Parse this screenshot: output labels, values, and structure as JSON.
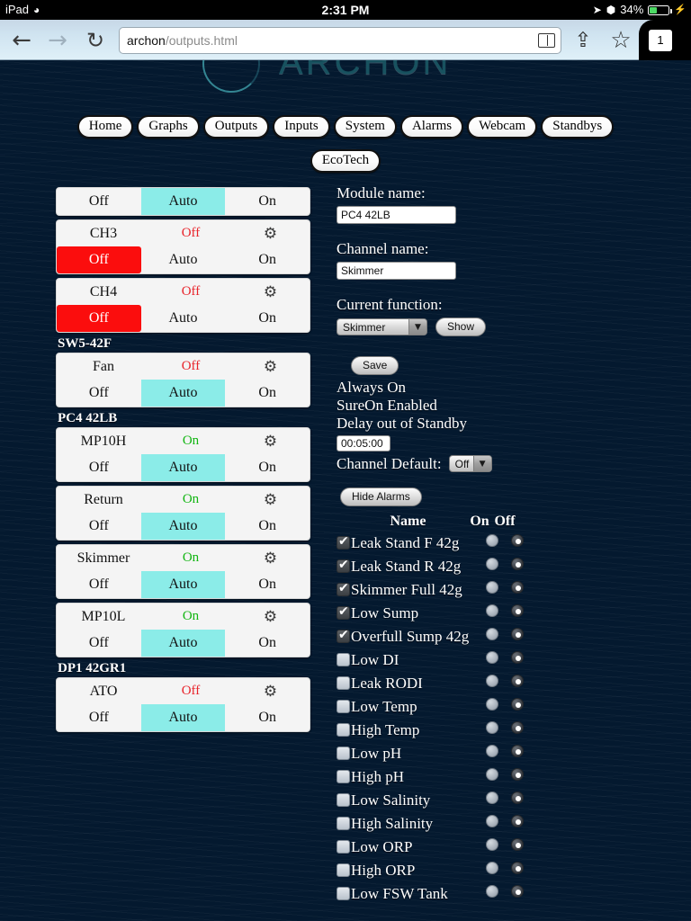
{
  "status_bar": {
    "device": "iPad",
    "wifi_icon": "wifi-icon",
    "time": "2:31 PM",
    "location_icon": "location-arrow-icon",
    "bluetooth_icon": "bluetooth-icon",
    "battery_percent": "34%",
    "charging_icon": "lightning-bolt-icon",
    "battery_level": 34
  },
  "browser": {
    "back_icon": "back-arrow-icon",
    "forward_icon": "forward-arrow-icon",
    "reload_icon": "reload-icon",
    "url_host": "archon",
    "url_path": "/outputs.html",
    "reader_icon": "reader-view-icon",
    "share_icon": "share-icon",
    "bookmark_icon": "bookmark-star-icon",
    "tab_count": "1"
  },
  "site": {
    "logo_text": "ARCHON",
    "nav": [
      {
        "label": "Home"
      },
      {
        "label": "Graphs"
      },
      {
        "label": "Outputs"
      },
      {
        "label": "Inputs"
      },
      {
        "label": "System"
      },
      {
        "label": "Alarms"
      },
      {
        "label": "Webcam"
      },
      {
        "label": "Standbys"
      }
    ],
    "subnav": [
      {
        "label": "EcoTech"
      }
    ]
  },
  "channels": {
    "partial_top": {
      "off_label": "Off",
      "auto_label": "Auto",
      "on_label": "On",
      "selected": "Auto"
    },
    "groups": [
      {
        "label": "",
        "items": [
          {
            "name": "CH3",
            "state": "Off",
            "state_kind": "off",
            "selected": "Off",
            "off_label": "Off",
            "auto_label": "Auto",
            "on_label": "On",
            "gear_icon": "gear-icon"
          },
          {
            "name": "CH4",
            "state": "Off",
            "state_kind": "off",
            "selected": "Off",
            "off_label": "Off",
            "auto_label": "Auto",
            "on_label": "On",
            "gear_icon": "gear-icon"
          }
        ]
      },
      {
        "label": "SW5-42F",
        "items": [
          {
            "name": "Fan",
            "state": "Off",
            "state_kind": "off",
            "selected": "Auto",
            "off_label": "Off",
            "auto_label": "Auto",
            "on_label": "On",
            "gear_icon": "gear-icon"
          }
        ]
      },
      {
        "label": "PC4 42LB",
        "items": [
          {
            "name": "MP10H",
            "state": "On",
            "state_kind": "on",
            "selected": "Auto",
            "off_label": "Off",
            "auto_label": "Auto",
            "on_label": "On",
            "gear_icon": "gear-icon"
          },
          {
            "name": "Return",
            "state": "On",
            "state_kind": "on",
            "selected": "Auto",
            "off_label": "Off",
            "auto_label": "Auto",
            "on_label": "On",
            "gear_icon": "gear-icon"
          },
          {
            "name": "Skimmer",
            "state": "On",
            "state_kind": "on",
            "selected": "Auto",
            "off_label": "Off",
            "auto_label": "Auto",
            "on_label": "On",
            "gear_icon": "gear-icon"
          },
          {
            "name": "MP10L",
            "state": "On",
            "state_kind": "on",
            "selected": "Auto",
            "off_label": "Off",
            "auto_label": "Auto",
            "on_label": "On",
            "gear_icon": "gear-icon"
          }
        ]
      },
      {
        "label": "DP1 42GR1",
        "items": [
          {
            "name": "ATO",
            "state": "Off",
            "state_kind": "off",
            "selected": "Auto",
            "off_label": "Off",
            "auto_label": "Auto",
            "on_label": "On",
            "gear_icon": "gear-icon"
          }
        ]
      }
    ]
  },
  "form": {
    "module_name_label": "Module name:",
    "module_name_value": "PC4 42LB",
    "channel_name_label": "Channel name:",
    "channel_name_value": "Skimmer",
    "current_function_label": "Current function:",
    "current_function_value": "Skimmer",
    "show_button": "Show",
    "save_button": "Save",
    "always_on": "Always On",
    "sure_on": "SureOn Enabled",
    "delay_label": "Delay out of Standby",
    "delay_value": "00:05:00",
    "channel_default_label": "Channel Default:",
    "channel_default_value": "Off",
    "dropdown_arrow_icon": "chevron-down-icon"
  },
  "alarms": {
    "hide_button": "Hide Alarms",
    "col_name": "Name",
    "col_on": "On",
    "col_off": "Off",
    "rows": [
      {
        "name": "Leak Stand F 42g",
        "checked": true,
        "mode": "Off"
      },
      {
        "name": "Leak Stand R 42g",
        "checked": true,
        "mode": "Off"
      },
      {
        "name": "Skimmer Full 42g",
        "checked": true,
        "mode": "Off"
      },
      {
        "name": "Low Sump",
        "checked": true,
        "mode": "Off"
      },
      {
        "name": "Overfull Sump 42g",
        "checked": true,
        "mode": "Off"
      },
      {
        "name": "Low DI",
        "checked": false,
        "mode": "Off"
      },
      {
        "name": "Leak RODI",
        "checked": false,
        "mode": "Off"
      },
      {
        "name": "Low Temp",
        "checked": false,
        "mode": "Off"
      },
      {
        "name": "High Temp",
        "checked": false,
        "mode": "Off"
      },
      {
        "name": "Low pH",
        "checked": false,
        "mode": "Off"
      },
      {
        "name": "High pH",
        "checked": false,
        "mode": "Off"
      },
      {
        "name": "Low Salinity",
        "checked": false,
        "mode": "Off"
      },
      {
        "name": "High Salinity",
        "checked": false,
        "mode": "Off"
      },
      {
        "name": "Low ORP",
        "checked": false,
        "mode": "Off"
      },
      {
        "name": "High ORP",
        "checked": false,
        "mode": "Off"
      },
      {
        "name": "Low FSW Tank",
        "checked": false,
        "mode": "Off"
      }
    ]
  },
  "colors": {
    "accent_auto": "#8bece8",
    "state_on": "#12b512",
    "state_off": "#e8232a",
    "off_selected": "#fb0d0d",
    "battery_green": "#4cd964"
  }
}
